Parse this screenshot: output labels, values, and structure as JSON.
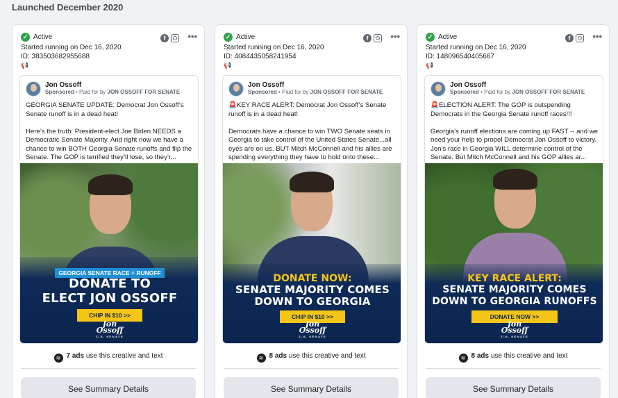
{
  "heading": "Launched December 2020",
  "cards": [
    {
      "status": "Active",
      "started": "Started running on Dec 16, 2020",
      "id": "ID: 383503682955688",
      "page_name": "Jon Ossoff",
      "sponsored": "Sponsored",
      "paid_prefix": " • Paid for by ",
      "paid_by": "JON OSSOFF FOR SENATE",
      "text_p1": "GEORGIA SENATE UPDATE: Democrat Jon Ossoff’s Senate runoff is in a dead heat!",
      "text_p2": "Here’s the truth: President-elect Joe Biden NEEDS a Democratic Senate Majority. And right now we have a chance to win BOTH Georgia Senate runoffs and flip the Senate. The GOP is terrified they’ll lose, so they’r...",
      "creative_tag": "GEORGIA SENATE RACE = RUNOFF",
      "creative_headline_1": "DONATE TO",
      "creative_headline_2": "ELECT JON OSSOFF",
      "creative_cta": "CHIP IN $10 >>",
      "logo_top": "Jon",
      "logo_main": "Ossoff",
      "logo_sub": "U.S. SENATE",
      "ads_count": "7 ads",
      "ads_suffix": " use this creative and text",
      "summary_button": "See Summary Details"
    },
    {
      "status": "Active",
      "started": "Started running on Dec 16, 2020",
      "id": "ID: 4084435058241954",
      "page_name": "Jon Ossoff",
      "sponsored": "Sponsored",
      "paid_prefix": " • Paid for by ",
      "paid_by": "JON OSSOFF FOR SENATE",
      "text_p1": "🚨KEY RACE ALERT: Democrat Jon Ossoff’s Senate runoff is in a dead heat!",
      "text_p2": "Democrats have a chance to win TWO Senate seats in Georgia to take control of the United States Senate...all eyes are on us. BUT Mitch McConnell and his allies are spending everything they have to hold onto these...",
      "creative_yellow": "DONATE NOW:",
      "creative_headline_1": "SENATE MAJORITY COMES",
      "creative_headline_2": "DOWN TO GEORGIA",
      "creative_cta": "CHIP IN $10 >>",
      "logo_top": "Jon",
      "logo_main": "Ossoff",
      "logo_sub": "U.S. SENATE",
      "ads_count": "8 ads",
      "ads_suffix": " use this creative and text",
      "summary_button": "See Summary Details"
    },
    {
      "status": "Active",
      "started": "Started running on Dec 16, 2020",
      "id": "ID: 148096540405667",
      "page_name": "Jon Ossoff",
      "sponsored": "Sponsored",
      "paid_prefix": " • Paid for by ",
      "paid_by": "JON OSSOFF FOR SENATE",
      "text_p1": "🚨ELECTION ALERT: The GOP is outspending Democrats in the Georgia Senate runoff races!!!",
      "text_p2": "Georgia’s runoff elections are coming up FAST -- and we need your help to propel Democrat Jon Ossoff to victory. Jon’s race in Georgia WILL determine control of the Senate. But Mitch McConnell and his GOP allies ar...",
      "creative_yellow": "KEY RACE ALERT:",
      "creative_headline_1": "SENATE MAJORITY COMES",
      "creative_headline_2": "DOWN TO GEORGIA RUNOFFS",
      "creative_cta": "DONATE NOW >>",
      "logo_top": "Jon",
      "logo_main": "Ossoff",
      "logo_sub": "U.S. SENATE",
      "ads_count": "8 ads",
      "ads_suffix": " use this creative and text",
      "summary_button": "See Summary Details"
    }
  ],
  "colors": {
    "active_green": "#31a24c",
    "banner_navy": "#0b2550",
    "cta_yellow": "#f5c518",
    "tag_blue": "#1e8fd6"
  },
  "icons": [
    "check-circle-icon",
    "facebook-icon",
    "instagram-icon",
    "more-options-icon",
    "megaphone-icon",
    "creative-stack-icon"
  ]
}
